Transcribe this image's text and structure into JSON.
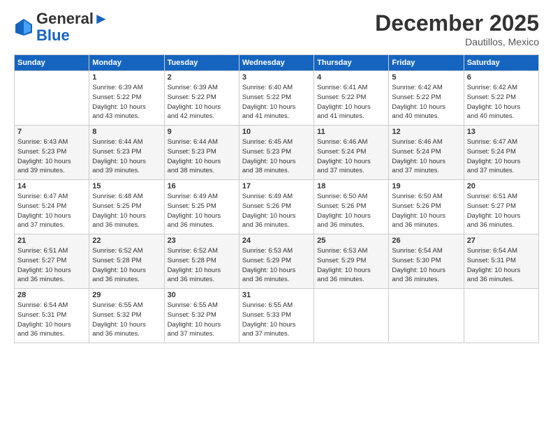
{
  "header": {
    "logo_line1": "General",
    "logo_line2": "Blue",
    "month": "December 2025",
    "location": "Dautillos, Mexico"
  },
  "days_of_week": [
    "Sunday",
    "Monday",
    "Tuesday",
    "Wednesday",
    "Thursday",
    "Friday",
    "Saturday"
  ],
  "weeks": [
    [
      {
        "day": "",
        "info": ""
      },
      {
        "day": "1",
        "info": "Sunrise: 6:39 AM\nSunset: 5:22 PM\nDaylight: 10 hours\nand 43 minutes."
      },
      {
        "day": "2",
        "info": "Sunrise: 6:39 AM\nSunset: 5:22 PM\nDaylight: 10 hours\nand 42 minutes."
      },
      {
        "day": "3",
        "info": "Sunrise: 6:40 AM\nSunset: 5:22 PM\nDaylight: 10 hours\nand 41 minutes."
      },
      {
        "day": "4",
        "info": "Sunrise: 6:41 AM\nSunset: 5:22 PM\nDaylight: 10 hours\nand 41 minutes."
      },
      {
        "day": "5",
        "info": "Sunrise: 6:42 AM\nSunset: 5:22 PM\nDaylight: 10 hours\nand 40 minutes."
      },
      {
        "day": "6",
        "info": "Sunrise: 6:42 AM\nSunset: 5:22 PM\nDaylight: 10 hours\nand 40 minutes."
      }
    ],
    [
      {
        "day": "7",
        "info": "Sunrise: 6:43 AM\nSunset: 5:23 PM\nDaylight: 10 hours\nand 39 minutes."
      },
      {
        "day": "8",
        "info": "Sunrise: 6:44 AM\nSunset: 5:23 PM\nDaylight: 10 hours\nand 39 minutes."
      },
      {
        "day": "9",
        "info": "Sunrise: 6:44 AM\nSunset: 5:23 PM\nDaylight: 10 hours\nand 38 minutes."
      },
      {
        "day": "10",
        "info": "Sunrise: 6:45 AM\nSunset: 5:23 PM\nDaylight: 10 hours\nand 38 minutes."
      },
      {
        "day": "11",
        "info": "Sunrise: 6:46 AM\nSunset: 5:24 PM\nDaylight: 10 hours\nand 37 minutes."
      },
      {
        "day": "12",
        "info": "Sunrise: 6:46 AM\nSunset: 5:24 PM\nDaylight: 10 hours\nand 37 minutes."
      },
      {
        "day": "13",
        "info": "Sunrise: 6:47 AM\nSunset: 5:24 PM\nDaylight: 10 hours\nand 37 minutes."
      }
    ],
    [
      {
        "day": "14",
        "info": "Sunrise: 6:47 AM\nSunset: 5:24 PM\nDaylight: 10 hours\nand 37 minutes."
      },
      {
        "day": "15",
        "info": "Sunrise: 6:48 AM\nSunset: 5:25 PM\nDaylight: 10 hours\nand 36 minutes."
      },
      {
        "day": "16",
        "info": "Sunrise: 6:49 AM\nSunset: 5:25 PM\nDaylight: 10 hours\nand 36 minutes."
      },
      {
        "day": "17",
        "info": "Sunrise: 6:49 AM\nSunset: 5:26 PM\nDaylight: 10 hours\nand 36 minutes."
      },
      {
        "day": "18",
        "info": "Sunrise: 6:50 AM\nSunset: 5:26 PM\nDaylight: 10 hours\nand 36 minutes."
      },
      {
        "day": "19",
        "info": "Sunrise: 6:50 AM\nSunset: 5:26 PM\nDaylight: 10 hours\nand 36 minutes."
      },
      {
        "day": "20",
        "info": "Sunrise: 6:51 AM\nSunset: 5:27 PM\nDaylight: 10 hours\nand 36 minutes."
      }
    ],
    [
      {
        "day": "21",
        "info": "Sunrise: 6:51 AM\nSunset: 5:27 PM\nDaylight: 10 hours\nand 36 minutes."
      },
      {
        "day": "22",
        "info": "Sunrise: 6:52 AM\nSunset: 5:28 PM\nDaylight: 10 hours\nand 36 minutes."
      },
      {
        "day": "23",
        "info": "Sunrise: 6:52 AM\nSunset: 5:28 PM\nDaylight: 10 hours\nand 36 minutes."
      },
      {
        "day": "24",
        "info": "Sunrise: 6:53 AM\nSunset: 5:29 PM\nDaylight: 10 hours\nand 36 minutes."
      },
      {
        "day": "25",
        "info": "Sunrise: 6:53 AM\nSunset: 5:29 PM\nDaylight: 10 hours\nand 36 minutes."
      },
      {
        "day": "26",
        "info": "Sunrise: 6:54 AM\nSunset: 5:30 PM\nDaylight: 10 hours\nand 36 minutes."
      },
      {
        "day": "27",
        "info": "Sunrise: 6:54 AM\nSunset: 5:31 PM\nDaylight: 10 hours\nand 36 minutes."
      }
    ],
    [
      {
        "day": "28",
        "info": "Sunrise: 6:54 AM\nSunset: 5:31 PM\nDaylight: 10 hours\nand 36 minutes."
      },
      {
        "day": "29",
        "info": "Sunrise: 6:55 AM\nSunset: 5:32 PM\nDaylight: 10 hours\nand 36 minutes."
      },
      {
        "day": "30",
        "info": "Sunrise: 6:55 AM\nSunset: 5:32 PM\nDaylight: 10 hours\nand 37 minutes."
      },
      {
        "day": "31",
        "info": "Sunrise: 6:55 AM\nSunset: 5:33 PM\nDaylight: 10 hours\nand 37 minutes."
      },
      {
        "day": "",
        "info": ""
      },
      {
        "day": "",
        "info": ""
      },
      {
        "day": "",
        "info": ""
      }
    ]
  ]
}
